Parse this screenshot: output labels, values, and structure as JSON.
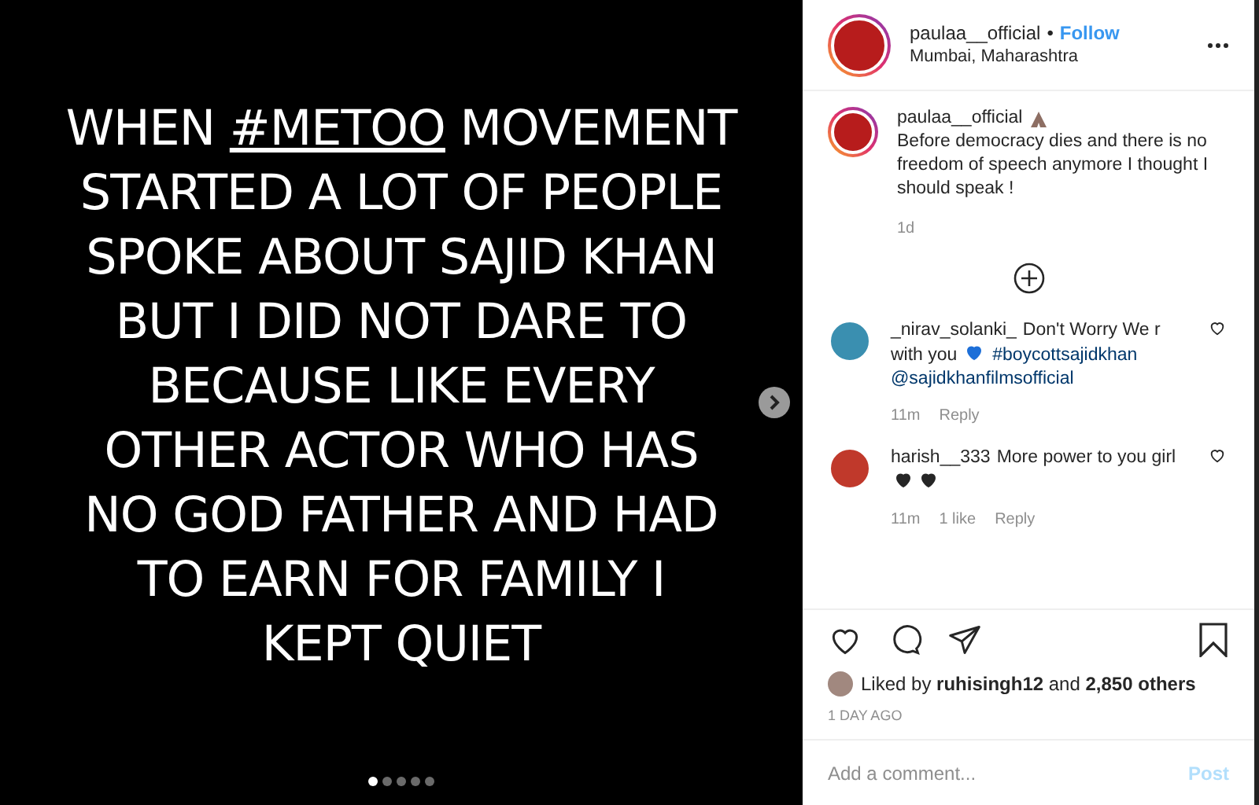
{
  "slide": {
    "before": "WHEN ",
    "hashtag": "#METOO",
    "after": " MOVEMENT",
    "lines": [
      "STARTED A LOT OF PEOPLE",
      "SPOKE ABOUT SAJID KHAN",
      "BUT I DID NOT DARE TO",
      "BECAUSE LIKE EVERY",
      "OTHER ACTOR WHO HAS",
      "NO GOD FATHER AND HAD",
      "TO EARN FOR FAMILY I",
      "KEPT QUIET"
    ],
    "dots": [
      {
        "selected": true
      },
      {
        "selected": false
      },
      {
        "selected": false
      },
      {
        "selected": false
      },
      {
        "selected": false
      }
    ]
  },
  "header": {
    "username": "paulaa__official",
    "separator": "•",
    "follow": "Follow",
    "location": "Mumbai, Maharashtra"
  },
  "caption": {
    "username": "paulaa__official",
    "text": "Before democracy dies and there is no freedom of speech anymore I thought I should speak !",
    "time": "1d"
  },
  "comments": [
    {
      "username": "_nirav_solanki_",
      "parts": [
        {
          "kind": "text",
          "text": "Don't Worry We r with you"
        },
        {
          "kind": "heart",
          "color": "#1d6fd8"
        },
        {
          "kind": "link",
          "text": "#boycottsajidkhan"
        },
        {
          "kind": "link",
          "text": "@sajidkhanfilmsofficial"
        }
      ],
      "meta": [
        "11m",
        "Reply"
      ]
    },
    {
      "username": "harish__333",
      "parts": [
        {
          "kind": "text",
          "text": "More power to you girl"
        },
        {
          "kind": "heart",
          "color": "#262626"
        },
        {
          "kind": "heart",
          "color": "#262626"
        }
      ],
      "meta": [
        "11m",
        "1 like",
        "Reply"
      ]
    }
  ],
  "likes": "Liked by **ruhisingh12** and **2,850 others**",
  "date": "1 DAY AGO",
  "add_comment": {
    "placeholder": "Add a comment...",
    "button": "Post",
    "button_disabled": true
  }
}
